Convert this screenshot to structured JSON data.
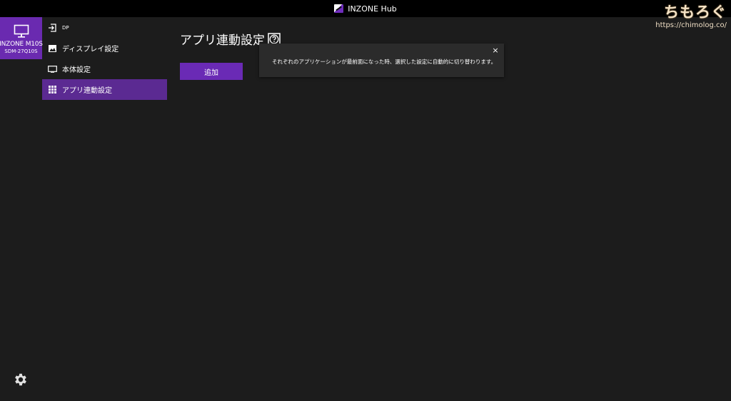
{
  "window": {
    "title": "INZONE Hub"
  },
  "watermark": {
    "main": "ちもろぐ",
    "url": "https://chimolog.co/"
  },
  "device": {
    "name": "INZONE M10S",
    "model": "SDM-27Q10S"
  },
  "nav": {
    "items": [
      {
        "label": "DP",
        "icon": "input-icon"
      },
      {
        "label": "ディスプレイ設定",
        "icon": "image-icon"
      },
      {
        "label": "本体設定",
        "icon": "monitor-icon"
      },
      {
        "label": "アプリ連動設定",
        "icon": "grid-icon",
        "active": true
      }
    ]
  },
  "main": {
    "title": "アプリ連動設定",
    "add_label": "追加"
  },
  "tooltip": {
    "text": "それぞれのアプリケーションが最前面になった時、選択した設定に自動的に切り替わります。",
    "close": "×"
  },
  "colors": {
    "accent": "#6a2ab0",
    "active_nav": "#5b2a92",
    "background": "#1c1c1c",
    "titlebar": "#000000",
    "tooltip_bg": "#2b2b2b"
  }
}
